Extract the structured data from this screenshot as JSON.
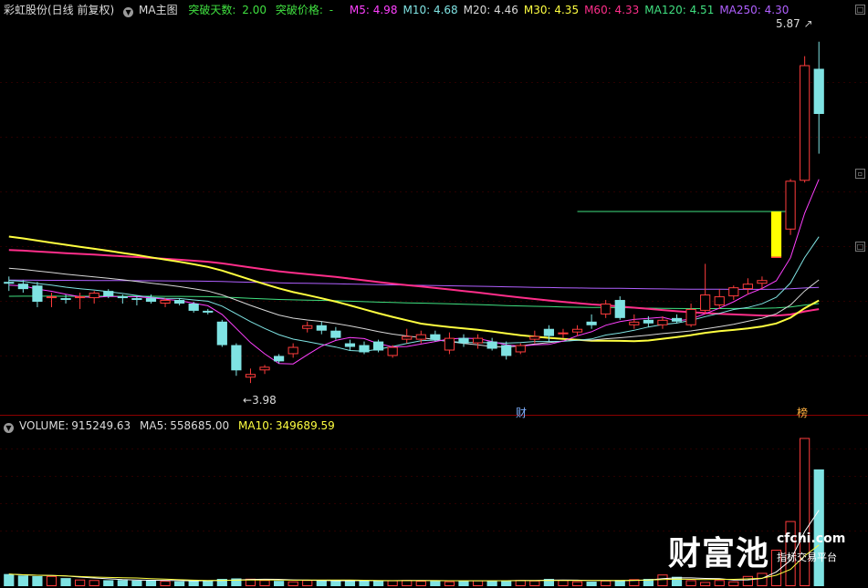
{
  "header": {
    "stock_name": "彩虹股份(日线 前复权)",
    "indicator": "MA主图",
    "breakout_days_label": "突破天数:",
    "breakout_days": "2.00",
    "breakout_price_label": "突破价格:",
    "breakout_price": "-",
    "ma": [
      {
        "label": "M5:",
        "value": "4.98",
        "color": "#ff40ff"
      },
      {
        "label": "M10:",
        "value": "4.68",
        "color": "#7fe3e3"
      },
      {
        "label": "M20:",
        "value": "4.46",
        "color": "#d8d8d8"
      },
      {
        "label": "M30:",
        "value": "4.35",
        "color": "#ffff40"
      },
      {
        "label": "M60:",
        "value": "4.33",
        "color": "#ff2e8a"
      },
      {
        "label": "MA120:",
        "value": "4.51",
        "color": "#40e080"
      },
      {
        "label": "MA250:",
        "value": "4.30",
        "color": "#b060ff"
      }
    ]
  },
  "volume_header": {
    "volume_label": "VOLUME:",
    "volume": "915249.63",
    "ma5_label": "MA5:",
    "ma5": "558685.00",
    "ma10_label": "MA10:",
    "ma10": "349689.59"
  },
  "annotations": {
    "high": "5.87",
    "low": "3.98",
    "marker_cai": "财",
    "marker_bang": "榜"
  },
  "watermark": {
    "brand": "财富池",
    "domain": "cfchi.com",
    "slogan": "指标交易平台"
  },
  "colors": {
    "up": "#ff3c3c",
    "down": "#7fe3e3",
    "signal": "#ffff00",
    "breakout_line": "#40e080",
    "grid": "#8b0000"
  },
  "chart_data": {
    "type": "candlestick",
    "ylim": [
      3.9,
      6.0
    ],
    "ohlc": [
      [
        4.54,
        4.57,
        4.49,
        4.53
      ],
      [
        4.53,
        4.55,
        4.48,
        4.5
      ],
      [
        4.52,
        4.54,
        4.4,
        4.43
      ],
      [
        4.45,
        4.48,
        4.4,
        4.46
      ],
      [
        4.45,
        4.47,
        4.42,
        4.44
      ],
      [
        4.45,
        4.48,
        4.39,
        4.46
      ],
      [
        4.45,
        4.49,
        4.42,
        4.48
      ],
      [
        4.49,
        4.5,
        4.45,
        4.46
      ],
      [
        4.46,
        4.47,
        4.42,
        4.45
      ],
      [
        4.45,
        4.46,
        4.41,
        4.44
      ],
      [
        4.45,
        4.47,
        4.42,
        4.43
      ],
      [
        4.42,
        4.45,
        4.4,
        4.44
      ],
      [
        4.44,
        4.45,
        4.41,
        4.42
      ],
      [
        4.42,
        4.43,
        4.37,
        4.38
      ],
      [
        4.38,
        4.39,
        4.36,
        4.37
      ],
      [
        4.32,
        4.33,
        4.18,
        4.19
      ],
      [
        4.19,
        4.2,
        4.02,
        4.05
      ],
      [
        4.01,
        4.06,
        3.98,
        4.03
      ],
      [
        4.05,
        4.08,
        4.03,
        4.07
      ],
      [
        4.13,
        4.14,
        4.09,
        4.1
      ],
      [
        4.14,
        4.2,
        4.12,
        4.18
      ],
      [
        4.28,
        4.32,
        4.26,
        4.3
      ],
      [
        4.3,
        4.32,
        4.25,
        4.27
      ],
      [
        4.27,
        4.29,
        4.22,
        4.23
      ],
      [
        4.2,
        4.22,
        4.16,
        4.18
      ],
      [
        4.19,
        4.21,
        4.14,
        4.15
      ],
      [
        4.21,
        4.22,
        4.15,
        4.16
      ],
      [
        4.13,
        4.19,
        4.12,
        4.18
      ],
      [
        4.22,
        4.28,
        4.2,
        4.24
      ],
      [
        4.22,
        4.27,
        4.2,
        4.25
      ],
      [
        4.25,
        4.27,
        4.21,
        4.22
      ],
      [
        4.16,
        4.26,
        4.14,
        4.23
      ],
      [
        4.23,
        4.25,
        4.18,
        4.2
      ],
      [
        4.2,
        4.25,
        4.17,
        4.23
      ],
      [
        4.21,
        4.23,
        4.16,
        4.17
      ],
      [
        4.19,
        4.21,
        4.11,
        4.13
      ],
      [
        4.15,
        4.2,
        4.14,
        4.19
      ],
      [
        4.22,
        4.27,
        4.2,
        4.24
      ],
      [
        4.28,
        4.3,
        4.21,
        4.24
      ],
      [
        4.25,
        4.28,
        4.23,
        4.26
      ],
      [
        4.26,
        4.3,
        4.24,
        4.28
      ],
      [
        4.32,
        4.36,
        4.28,
        4.3
      ],
      [
        4.36,
        4.44,
        4.34,
        4.42
      ],
      [
        4.44,
        4.46,
        4.33,
        4.34
      ],
      [
        4.3,
        4.36,
        4.28,
        4.32
      ],
      [
        4.33,
        4.35,
        4.29,
        4.31
      ],
      [
        4.3,
        4.35,
        4.28,
        4.33
      ],
      [
        4.34,
        4.36,
        4.31,
        4.32
      ],
      [
        4.3,
        4.42,
        4.29,
        4.39
      ],
      [
        4.38,
        4.64,
        4.36,
        4.47
      ],
      [
        4.41,
        4.5,
        4.39,
        4.46
      ],
      [
        4.46,
        4.52,
        4.44,
        4.51
      ],
      [
        4.5,
        4.56,
        4.47,
        4.53
      ],
      [
        4.53,
        4.57,
        4.5,
        4.55
      ],
      [
        4.68,
        4.68,
        4.68,
        4.68
      ],
      [
        4.83,
        5.11,
        4.8,
        5.1
      ],
      [
        5.1,
        5.79,
        5.09,
        5.74
      ],
      [
        5.72,
        5.87,
        5.25,
        5.47
      ]
    ],
    "signal_bar_index": 54,
    "breakout_level": 4.93,
    "volume": [
      75000,
      66000,
      62000,
      63000,
      50000,
      41000,
      38000,
      37000,
      38000,
      35000,
      36000,
      33000,
      30000,
      33000,
      36000,
      45000,
      48000,
      46000,
      38000,
      33000,
      30000,
      38000,
      36000,
      32000,
      33000,
      34000,
      33000,
      36000,
      38000,
      33000,
      32000,
      30000,
      34000,
      36000,
      33000,
      35000,
      38000,
      35000,
      45000,
      38000,
      30000,
      28000,
      35000,
      38000,
      43000,
      45000,
      72000,
      58000,
      37000,
      26000,
      38000,
      30000,
      63000,
      82000,
      225000,
      402000,
      915000,
      721000
    ]
  }
}
